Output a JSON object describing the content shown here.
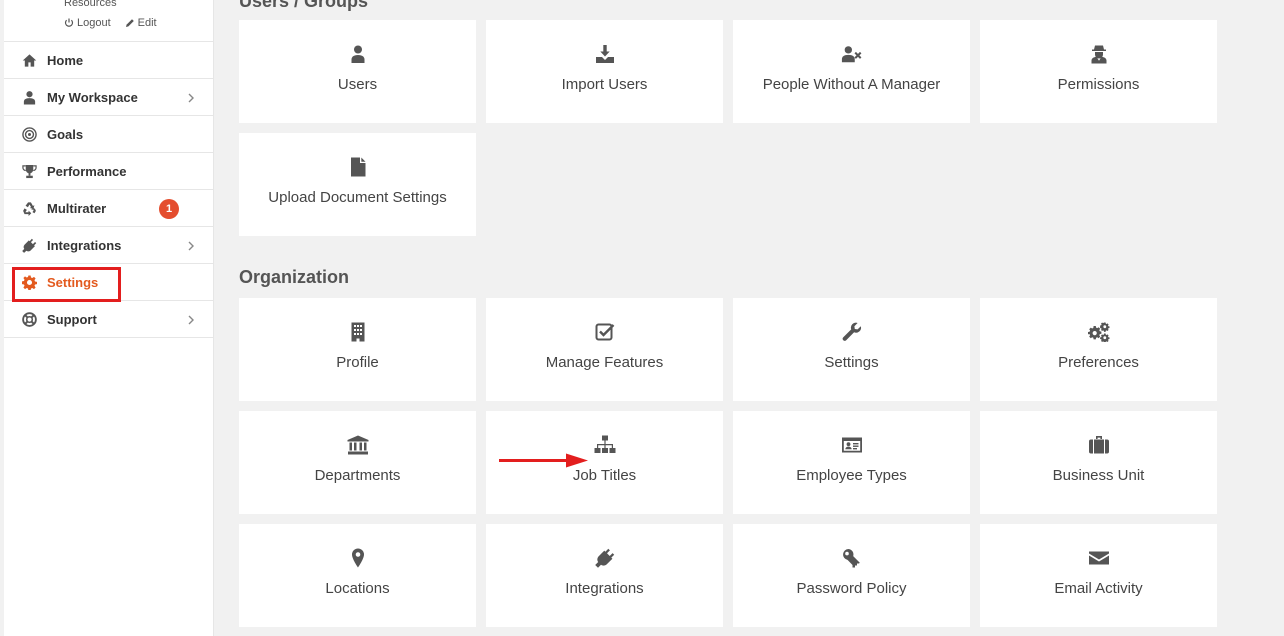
{
  "profile": {
    "name_partial": "Resources",
    "logout_label": "Logout",
    "edit_label": "Edit"
  },
  "sidebar": {
    "items": [
      {
        "label": "Home",
        "icon": "home-icon"
      },
      {
        "label": "My Workspace",
        "icon": "user-icon",
        "has_children": true
      },
      {
        "label": "Goals",
        "icon": "target-icon"
      },
      {
        "label": "Performance",
        "icon": "trophy-icon"
      },
      {
        "label": "Multirater",
        "icon": "recycle-icon",
        "badge": "1"
      },
      {
        "label": "Integrations",
        "icon": "plug-icon",
        "has_children": true
      },
      {
        "label": "Settings",
        "icon": "gear-icon",
        "active": true
      },
      {
        "label": "Support",
        "icon": "lifebuoy-icon",
        "has_children": true
      }
    ]
  },
  "sections": {
    "users_groups": {
      "title": "Users / Groups",
      "tiles": [
        {
          "label": "Users",
          "icon": "user-icon"
        },
        {
          "label": "Import Users",
          "icon": "download-icon"
        },
        {
          "label": "People Without A Manager",
          "icon": "user-times-icon"
        },
        {
          "label": "Permissions",
          "icon": "user-secret-icon"
        },
        {
          "label": "Upload Document Settings",
          "icon": "file-icon"
        }
      ]
    },
    "organization": {
      "title": "Organization",
      "tiles": [
        {
          "label": "Profile",
          "icon": "building-icon"
        },
        {
          "label": "Manage Features",
          "icon": "check-square-icon"
        },
        {
          "label": "Settings",
          "icon": "wrench-icon"
        },
        {
          "label": "Preferences",
          "icon": "cogs-icon"
        },
        {
          "label": "Departments",
          "icon": "bank-icon"
        },
        {
          "label": "Job Titles",
          "icon": "sitemap-icon"
        },
        {
          "label": "Employee Types",
          "icon": "id-card-icon"
        },
        {
          "label": "Business Unit",
          "icon": "briefcase-icon"
        },
        {
          "label": "Locations",
          "icon": "map-marker-icon"
        },
        {
          "label": "Integrations",
          "icon": "plug-icon"
        },
        {
          "label": "Password Policy",
          "icon": "key-icon"
        },
        {
          "label": "Email Activity",
          "icon": "envelope-icon"
        }
      ]
    }
  },
  "colors": {
    "accent": "#e35a1f",
    "badge": "#e44d2e",
    "highlight": "#e31e1e",
    "background": "#f1f1f1"
  }
}
